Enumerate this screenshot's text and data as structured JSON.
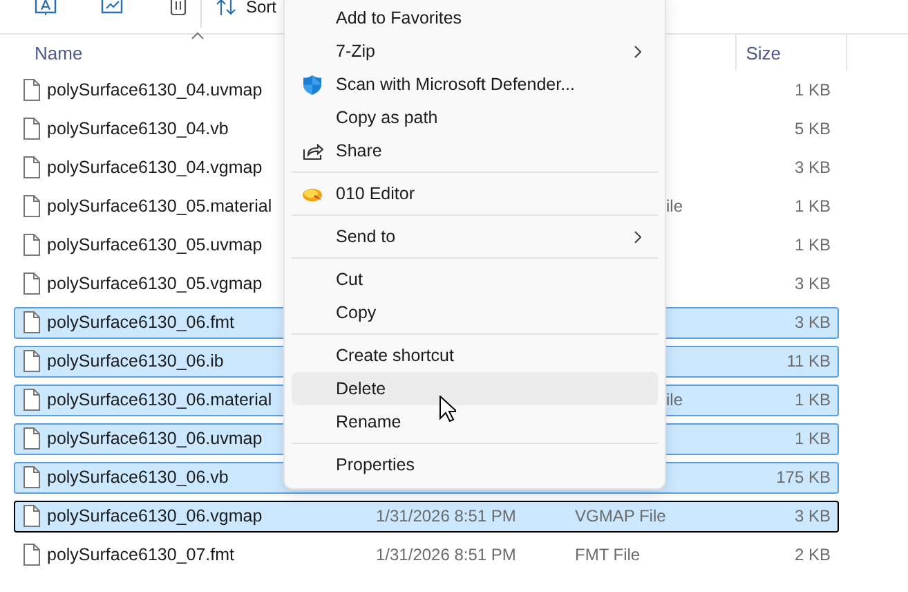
{
  "toolbar": {
    "sort_label": "Sort"
  },
  "columns": {
    "name": "Name",
    "size": "Size"
  },
  "rows": [
    {
      "name": "polySurface6130_04.uvmap",
      "size": "1 KB",
      "selected": false,
      "focused": false
    },
    {
      "name": "polySurface6130_04.vb",
      "size": "5 KB",
      "selected": false,
      "focused": false
    },
    {
      "name": "polySurface6130_04.vgmap",
      "size": "3 KB",
      "selected": false,
      "focused": false
    },
    {
      "name": "polySurface6130_05.material",
      "type": "ile",
      "size": "1 KB",
      "selected": false,
      "focused": false
    },
    {
      "name": "polySurface6130_05.uvmap",
      "size": "1 KB",
      "selected": false,
      "focused": false
    },
    {
      "name": "polySurface6130_05.vgmap",
      "size": "3 KB",
      "selected": false,
      "focused": false
    },
    {
      "name": "polySurface6130_06.fmt",
      "size": "3 KB",
      "selected": true,
      "focused": false
    },
    {
      "name": "polySurface6130_06.ib",
      "size": "11 KB",
      "selected": true,
      "focused": false
    },
    {
      "name": "polySurface6130_06.material",
      "type": "ile",
      "size": "1 KB",
      "selected": true,
      "focused": false
    },
    {
      "name": "polySurface6130_06.uvmap",
      "size": "1 KB",
      "selected": true,
      "focused": false
    },
    {
      "name": "polySurface6130_06.vb",
      "size": "175 KB",
      "selected": true,
      "focused": false
    },
    {
      "name": "polySurface6130_06.vgmap",
      "date": "1/31/2026 8:51 PM",
      "type": "VGMAP File",
      "size": "3 KB",
      "selected": true,
      "focused": true
    },
    {
      "name": "polySurface6130_07.fmt",
      "date": "1/31/2026 8:51 PM",
      "type": "FMT File",
      "size": "2 KB",
      "selected": false,
      "focused": false
    }
  ],
  "context_menu": [
    {
      "kind": "item",
      "label": "Add to Favorites",
      "submenu": false,
      "hovered": false
    },
    {
      "kind": "item",
      "label": "7-Zip",
      "submenu": true,
      "hovered": false
    },
    {
      "kind": "item",
      "label": "Scan with Microsoft Defender...",
      "submenu": false,
      "hovered": false
    },
    {
      "kind": "item",
      "label": "Copy as path",
      "submenu": false,
      "hovered": false
    },
    {
      "kind": "item",
      "label": "Share",
      "submenu": false,
      "hovered": false
    },
    {
      "kind": "separator"
    },
    {
      "kind": "item",
      "label": "010 Editor",
      "submenu": false,
      "hovered": false
    },
    {
      "kind": "separator"
    },
    {
      "kind": "item",
      "label": "Send to",
      "submenu": true,
      "hovered": false
    },
    {
      "kind": "separator"
    },
    {
      "kind": "item",
      "label": "Cut",
      "submenu": false,
      "hovered": false
    },
    {
      "kind": "item",
      "label": "Copy",
      "submenu": false,
      "hovered": false
    },
    {
      "kind": "separator"
    },
    {
      "kind": "item",
      "label": "Create shortcut",
      "submenu": false,
      "hovered": false
    },
    {
      "kind": "item",
      "label": "Delete",
      "submenu": false,
      "hovered": true
    },
    {
      "kind": "item",
      "label": "Rename",
      "submenu": false,
      "hovered": false
    },
    {
      "kind": "separator"
    },
    {
      "kind": "item",
      "label": "Properties",
      "submenu": false,
      "hovered": false
    }
  ]
}
